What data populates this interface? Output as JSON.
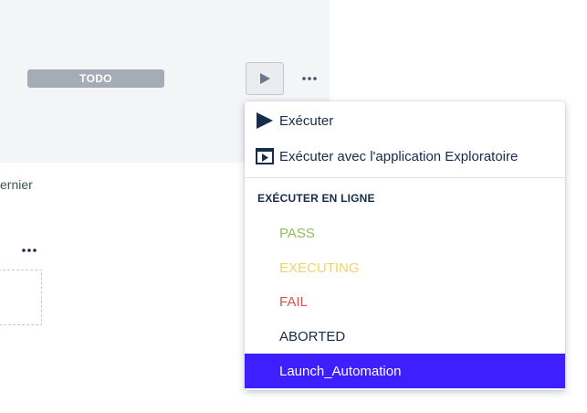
{
  "card": {
    "status_label": "TODO",
    "link_text": "ernier"
  },
  "menu": {
    "items": [
      {
        "label": "Exécuter",
        "icon": "play-icon"
      },
      {
        "label": "Exécuter avec l'application Exploratoire",
        "icon": "exploratory-player-icon"
      }
    ],
    "group_title": "EXÉCUTER EN LIGNE",
    "statuses": [
      {
        "label": "PASS",
        "color": "#8fbf5a"
      },
      {
        "label": "EXECUTING",
        "color": "#f1d36b"
      },
      {
        "label": "FAIL",
        "color": "#d9534f"
      },
      {
        "label": "ABORTED",
        "color": "#172b4d"
      },
      {
        "label": "Launch_Automation",
        "color": "#ffffff",
        "selected": true,
        "selected_bg": "#3e1fff"
      }
    ]
  }
}
